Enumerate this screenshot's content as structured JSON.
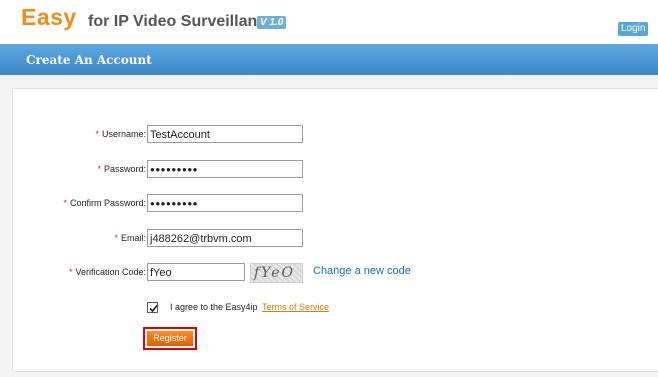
{
  "header": {
    "logo_main": "Easy",
    "logo_sub": "for IP Video Surveillance",
    "version": "V 1.0",
    "login_label": "Login"
  },
  "titlebar": {
    "title": "Create An Account"
  },
  "form": {
    "username_label": "Username:",
    "username_value": "TestAccount",
    "password_label": "Password:",
    "password_value": "●●●●●●●●●",
    "confirm_label": "Confirm Password:",
    "confirm_value": "●●●●●●●●●",
    "email_label": "Email:",
    "email_value": "j488262@trbvm.com",
    "verification_label": "Verification Code:",
    "verification_value": "fYeo",
    "captcha_text": "fYeO",
    "change_code_label": "Change a new code",
    "agree_text": "I agree to the Easy4ip",
    "tos_label": "Terms of Service",
    "register_label": "Register",
    "required_mark": "*",
    "agree_checked": true
  }
}
